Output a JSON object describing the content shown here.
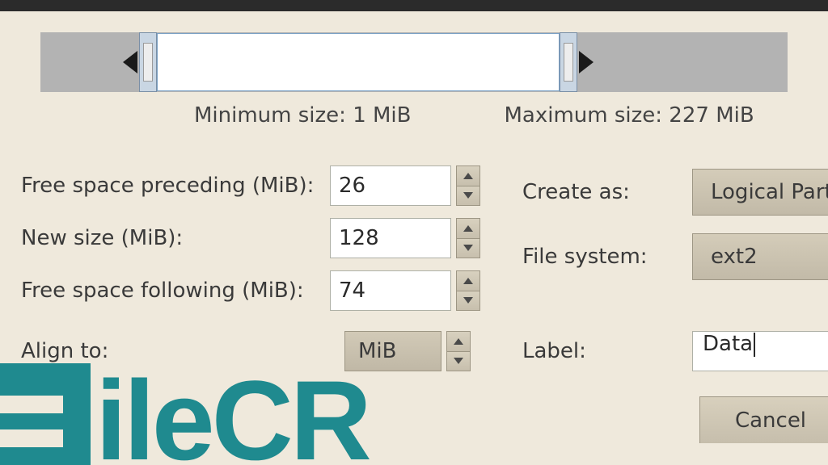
{
  "slider": {
    "preceding_pct": 11,
    "partition_pct": 56,
    "following_pct": 33
  },
  "captions": {
    "min": "Minimum size: 1 MiB",
    "max": "Maximum size: 227 MiB"
  },
  "left": {
    "preceding_label": "Free space preceding (MiB):",
    "preceding_value": "26",
    "newsize_label": "New size (MiB):",
    "newsize_value": "128",
    "following_label": "Free space following (MiB):",
    "following_value": "74",
    "align_label": "Align to:",
    "align_value": "MiB"
  },
  "right": {
    "create_as_label": "Create as:",
    "create_as_value": "Logical Part",
    "fs_label": "File system:",
    "fs_value": "ext2",
    "label_label": "Label:",
    "label_value": "Data"
  },
  "buttons": {
    "cancel": "Cancel"
  },
  "watermark": "ileCR"
}
